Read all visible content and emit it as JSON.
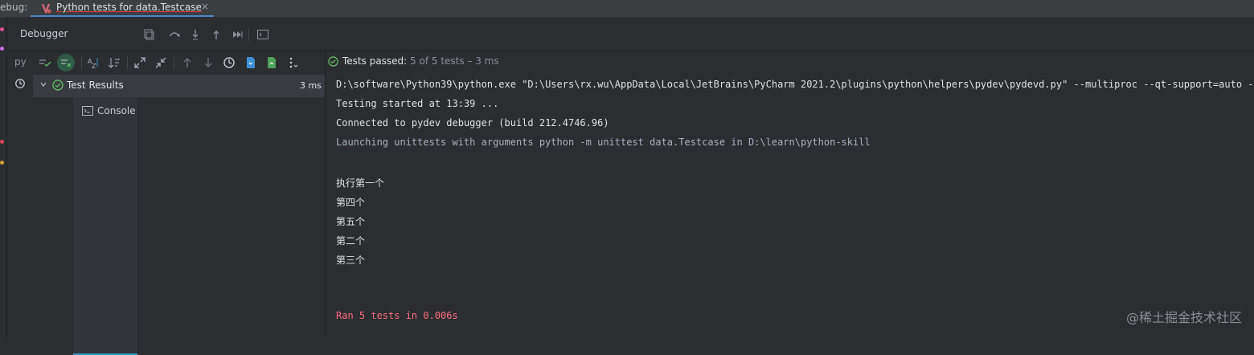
{
  "top_bar": {
    "debug_label": "ebug:",
    "tab_title": "Python tests for data.Testcase",
    "close_glyph": "×"
  },
  "subtabs": {
    "debugger": "Debugger",
    "console": "Console"
  },
  "toolbar": {
    "py_label": "py",
    "icons": [
      "rerun-icon",
      "show-passed-icon",
      "show-ignored-icon",
      "sort-alpha-icon",
      "sort-duration-icon",
      "expand-all-icon",
      "collapse-all-icon",
      "previous-failed-icon",
      "next-failed-icon",
      "history-icon",
      "import-tests-icon",
      "export-tests-icon",
      "more-icon"
    ]
  },
  "tree": {
    "root_label": "Test Results",
    "root_time": "3 ms"
  },
  "status": {
    "passed": "Tests passed:",
    "counts": "5 of 5 tests – 3 ms"
  },
  "console": {
    "lines": [
      "D:\\software\\Python39\\python.exe \"D:\\Users\\rx.wu\\AppData\\Local\\JetBrains\\PyCharm 2021.2\\plugins\\python\\helpers\\pydev\\pydevd.py\" --multiproc --qt-support=auto --clie",
      "Testing started at 13:39 ...",
      "Connected to pydev debugger (build 212.4746.96)",
      "Launching unittests with arguments python -m unittest data.Testcase in D:\\learn\\python-skill",
      "执行第一个",
      "第四个",
      "第五个",
      "第二个",
      "第三个",
      "Ran 5 tests in 0.006s"
    ]
  },
  "watermark": "@稀土掘金技术社区",
  "colors": {
    "accent_blue": "#3592c4",
    "pass_green": "#5fb865",
    "error_red": "#ff6b7f"
  }
}
